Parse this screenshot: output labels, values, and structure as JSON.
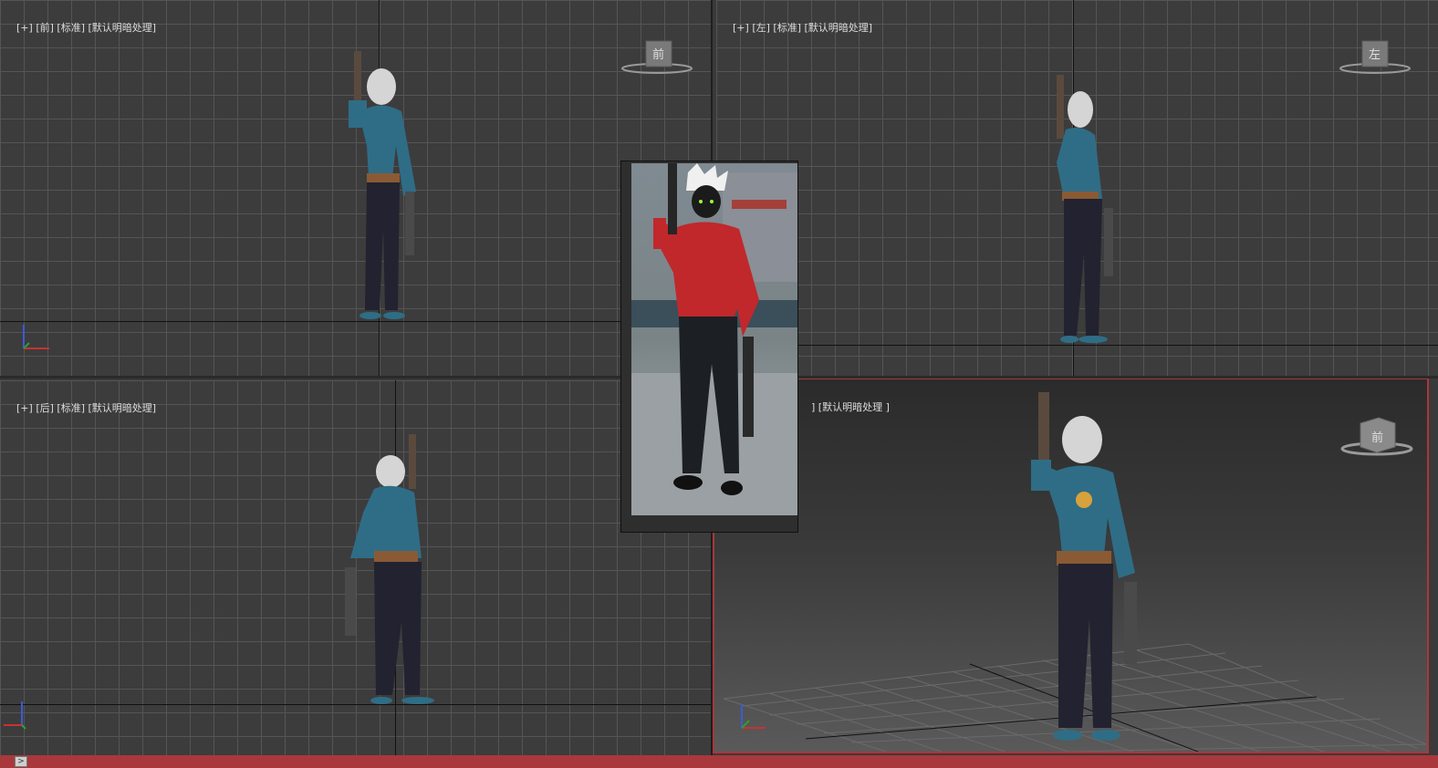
{
  "viewports": {
    "front": {
      "labels": [
        "[+]",
        "[前]",
        "[标准]",
        "[默认明暗处理]"
      ],
      "cube_label": "前"
    },
    "left": {
      "labels": [
        "[+]",
        "[左]",
        "[标准]",
        "[默认明暗处理]"
      ],
      "cube_label": "左"
    },
    "back": {
      "labels": [
        "[+]",
        "[后]",
        "[标准]",
        "[默认明暗处理]"
      ]
    },
    "perspective": {
      "visible_label": "] [默认明暗处理 ]",
      "cube_label": "前"
    }
  },
  "icons": {
    "viewcube": "viewcube-icon",
    "axis": "axis-gizmo-icon",
    "reference": "reference-image",
    "status_expand": "expand-arrow-icon"
  },
  "colors": {
    "active_border": "#a8383c",
    "grid_line": "#555555",
    "viewport_bg": "#3c3c3c",
    "model_skin": "#2f6d86",
    "jacket": "#c0282c"
  },
  "statusbar": {
    "button_glyph": ">"
  }
}
